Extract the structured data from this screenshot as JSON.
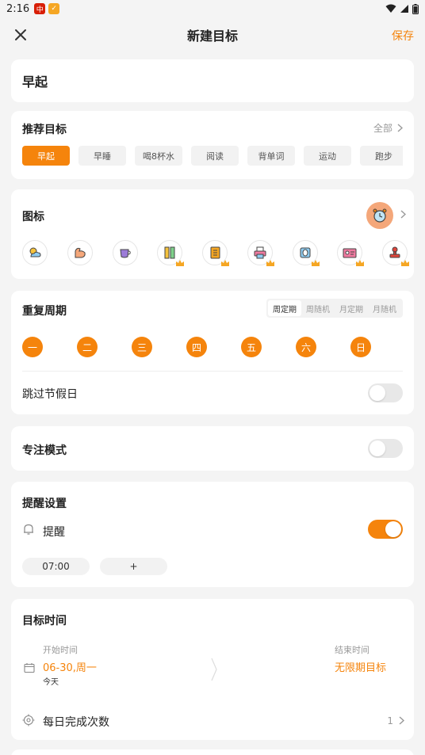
{
  "status_bar": {
    "time": "2:16"
  },
  "header": {
    "title": "新建目标",
    "save_label": "保存"
  },
  "goal_name": "早起",
  "recommend": {
    "title": "推荐目标",
    "all_label": "全部",
    "chips": [
      "早起",
      "早睡",
      "喝8杯水",
      "阅读",
      "背单词",
      "运动",
      "跑步"
    ],
    "active_index": 0
  },
  "icons": {
    "title": "图标",
    "items": [
      "weather-icon",
      "muscle-icon",
      "cup-icon",
      "ruler-pencil-icon",
      "notebook-icon",
      "printer-icon",
      "bug-icon",
      "id-card-icon",
      "stamp-icon"
    ]
  },
  "repeat": {
    "title": "重复周期",
    "modes": [
      "周定期",
      "周随机",
      "月定期",
      "月随机"
    ],
    "active_mode": 0,
    "days": [
      "一",
      "二",
      "三",
      "四",
      "五",
      "六",
      "日"
    ],
    "skip_holidays_label": "跳过节假日",
    "skip_holidays_on": false
  },
  "focus": {
    "title": "专注模式",
    "on": false
  },
  "reminder": {
    "title": "提醒设置",
    "label": "提醒",
    "on": true,
    "times": [
      "07:00",
      "+"
    ]
  },
  "target_time": {
    "title": "目标时间",
    "start_label": "开始时间",
    "start_value": "06-30,周一",
    "start_sub": "今天",
    "end_label": "结束时间",
    "end_value": "无限期目标",
    "daily_label": "每日完成次数",
    "daily_value": "1"
  },
  "colors": {
    "accent": "#f5840c",
    "background": "#f4f4f4"
  }
}
